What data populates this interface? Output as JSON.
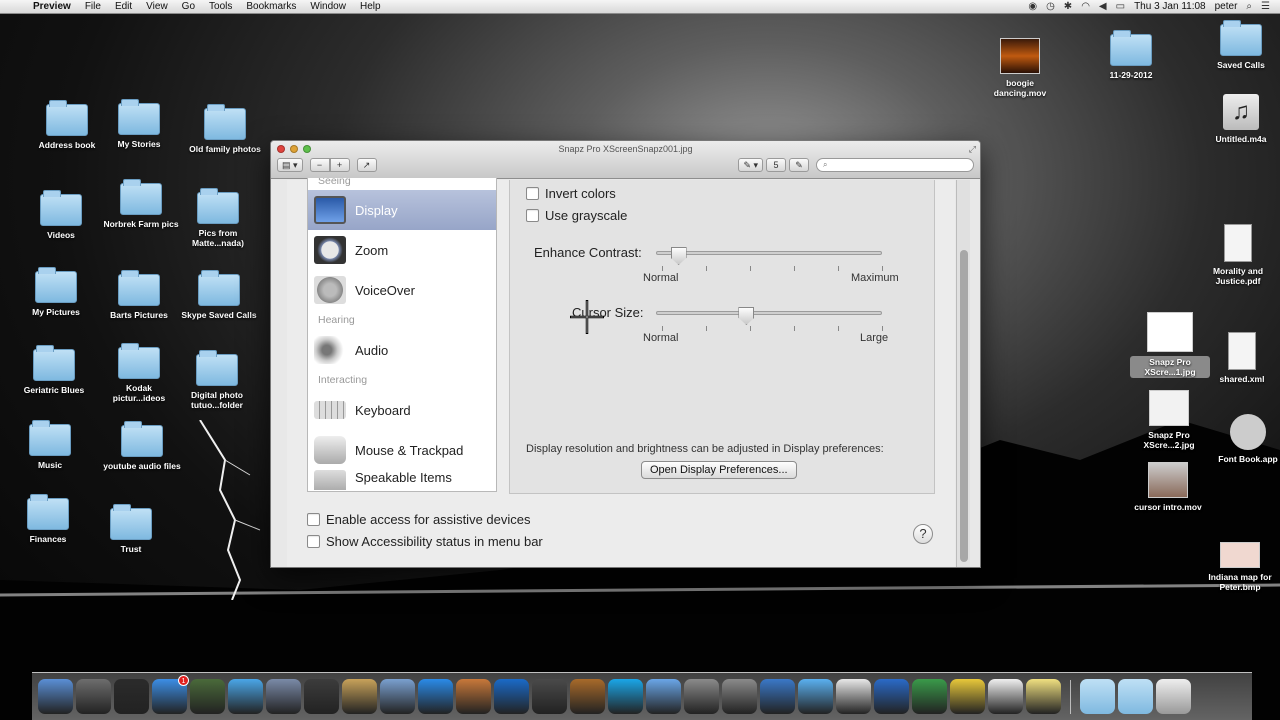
{
  "menubar": {
    "app": "Preview",
    "items": [
      "File",
      "Edit",
      "View",
      "Go",
      "Tools",
      "Bookmarks",
      "Window",
      "Help"
    ],
    "clock": "Thu 3 Jan  11:08",
    "user": "peter"
  },
  "desktop": {
    "left_icons": [
      {
        "label": "Address book",
        "kind": "folder"
      },
      {
        "label": "My Stories",
        "kind": "folder"
      },
      {
        "label": "Old family photos",
        "kind": "folder"
      },
      {
        "label": "Videos",
        "kind": "folder"
      },
      {
        "label": "Norbrek Farm pics",
        "kind": "folder"
      },
      {
        "label": "Pics from Matte...nada)",
        "kind": "folder"
      },
      {
        "label": "My Pictures",
        "kind": "folder"
      },
      {
        "label": "Barts Pictures",
        "kind": "folder"
      },
      {
        "label": "Skype Saved Calls",
        "kind": "folder"
      },
      {
        "label": "Geriatric Blues",
        "kind": "folder"
      },
      {
        "label": "Kodak pictur...ideos",
        "kind": "folder"
      },
      {
        "label": "Digital photo tutuo...folder",
        "kind": "folder"
      },
      {
        "label": "Music",
        "kind": "folder"
      },
      {
        "label": "youtube audio files",
        "kind": "folder"
      },
      {
        "label": "Finances",
        "kind": "folder"
      },
      {
        "label": "Trust",
        "kind": "folder"
      }
    ],
    "right_icons": [
      {
        "label": "boogie dancing.mov",
        "kind": "thumb"
      },
      {
        "label": "11-29-2012",
        "kind": "folder"
      },
      {
        "label": "Saved Calls",
        "kind": "folder"
      },
      {
        "label": "Untitled.m4a",
        "kind": "music"
      },
      {
        "label": "Morality and Justice.pdf",
        "kind": "doc"
      },
      {
        "label": "Snapz Pro XScre...1.jpg",
        "kind": "thumb"
      },
      {
        "label": "shared.xml",
        "kind": "doc"
      },
      {
        "label": "Snapz Pro XScre...2.jpg",
        "kind": "thumb"
      },
      {
        "label": "Font Book.app",
        "kind": "app"
      },
      {
        "label": "cursor intro.mov",
        "kind": "thumb"
      },
      {
        "label": "Indiana map for Peter.bmp",
        "kind": "thumb"
      }
    ]
  },
  "window": {
    "title": "Snapz Pro XScreenSnapz001.jpg",
    "toolbar": {
      "zoom_out": "−",
      "zoom_in": "+",
      "share": "↗",
      "page": "5",
      "search_placeholder": ""
    },
    "sidebar": {
      "sections": [
        {
          "header": "Seeing",
          "items": [
            {
              "label": "Display",
              "selected": true
            },
            {
              "label": "Zoom",
              "selected": false
            },
            {
              "label": "VoiceOver",
              "selected": false
            }
          ]
        },
        {
          "header": "Hearing",
          "items": [
            {
              "label": "Audio",
              "selected": false
            }
          ]
        },
        {
          "header": "Interacting",
          "items": [
            {
              "label": "Keyboard",
              "selected": false
            },
            {
              "label": "Mouse & Trackpad",
              "selected": false
            },
            {
              "label": "Speakable Items",
              "selected": false
            }
          ]
        }
      ]
    },
    "panel": {
      "invert_colors": {
        "label": "Invert colors",
        "checked": false
      },
      "use_grayscale": {
        "label": "Use grayscale",
        "checked": false
      },
      "enhance_contrast": {
        "label": "Enhance Contrast:",
        "min": "Normal",
        "max": "Maximum",
        "value": 0.1
      },
      "cursor_size": {
        "label": "Cursor Size:",
        "min": "Normal",
        "max": "Large",
        "value": 0.4
      },
      "note": "Display resolution and brightness can be adjusted in Display preferences:",
      "open_prefs_button": "Open Display Preferences..."
    },
    "bottom": {
      "enable_access": {
        "label": "Enable access for assistive devices",
        "checked": false
      },
      "show_status": {
        "label": "Show Accessibility status in menu bar",
        "checked": false
      },
      "help": "?"
    }
  },
  "dock": {
    "apps": [
      "finder-icon",
      "launchpad-icon",
      "dashboard-icon",
      "app-store-icon",
      "photo-booth-icon",
      "safari-icon",
      "mail-icon",
      "facetime-icon",
      "address-book-icon",
      "iphoto-icon",
      "itunes-icon",
      "iphoto-library-icon",
      "preview-icon",
      "imovie-icon",
      "garageband-icon",
      "skype-icon",
      "mail-bird-icon",
      "photo-tool-icon",
      "system-preferences-icon",
      "dvd-player-icon",
      "messages-icon",
      "solitaire-icon",
      "quicktime-icon",
      "chrome-icon",
      "vlc-icon",
      "textedit-icon",
      "stickies-icon"
    ],
    "app_store_badge": "1",
    "right": [
      "applications-folder-icon",
      "documents-folder-icon",
      "trash-icon"
    ]
  },
  "colors": {
    "selection": "#97a5c8",
    "folder": "#7fb9e0"
  }
}
